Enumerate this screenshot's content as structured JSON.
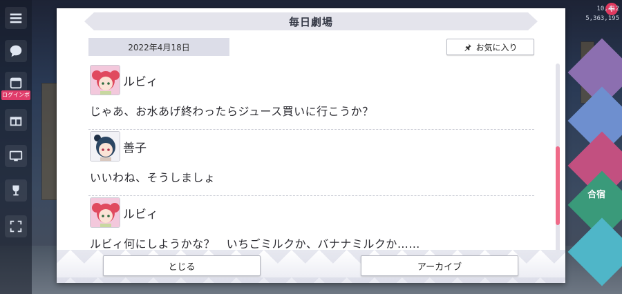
{
  "dialog": {
    "title": "毎日劇場",
    "date": "2022年4月18日",
    "favorite_label": "お気に入り",
    "close_label": "とじる",
    "archive_label": "アーカイブ"
  },
  "messages": [
    {
      "speaker": "ルビィ",
      "text": "じゃあ、お水あげ終わったらジュース買いに行こうか？"
    },
    {
      "speaker": "善子",
      "text": "いいわね、そうしましょ"
    },
    {
      "speaker": "ルビィ",
      "text": "ルビィ何にしようかな？　いちごミルクか、バナナミルクか……"
    }
  ],
  "background": {
    "event_tag": "ログインボ",
    "counter_top": "10,412",
    "counter_bottom": "5,363,195",
    "gassyuku_label": "合宿"
  },
  "colors": {
    "scroll_thumb": "#ef6a88",
    "ruby_hair": "#e04a5f",
    "yoshiko_hair": "#2b4663"
  },
  "icons": {
    "favorite": "pin-icon",
    "menu": "hamburger-icon"
  }
}
